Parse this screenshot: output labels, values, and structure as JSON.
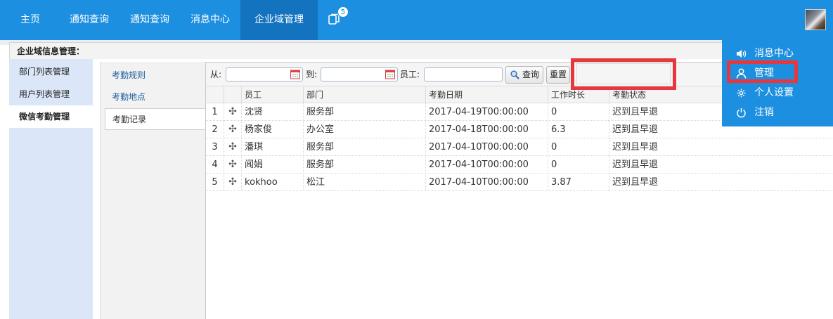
{
  "nav": {
    "items": [
      "主页",
      "通知查询",
      "通知查询",
      "消息中心",
      "企业域管理"
    ],
    "active_index": 4,
    "message_badge": "5"
  },
  "breadcrumb": "企业域信息管理：",
  "sidebar": {
    "items": [
      "部门列表管理",
      "用户列表管理",
      "微信考勤管理"
    ],
    "active_index": 2
  },
  "subsidebar": {
    "items": [
      "考勤规则",
      "考勤地点",
      "考勤记录"
    ],
    "active_index": 2
  },
  "toolbar": {
    "from_label": "从:",
    "from_value": "",
    "to_label": "到:",
    "to_value": "",
    "employee_label": "员工:",
    "employee_value": "",
    "search_button": "查询",
    "reset_button": "重置"
  },
  "table": {
    "columns": [
      "员工",
      "部门",
      "考勤日期",
      "工作时长",
      "考勤状态"
    ],
    "rows": [
      {
        "idx": "1",
        "employee": "沈贤",
        "dept": "服务部",
        "date": "2017-04-19T00:00:00",
        "hours": "0",
        "status": "迟到且早退"
      },
      {
        "idx": "2",
        "employee": "杨家俊",
        "dept": "办公室",
        "date": "2017-04-18T00:00:00",
        "hours": "6.3",
        "status": "迟到且早退"
      },
      {
        "idx": "3",
        "employee": "潘琪",
        "dept": "服务部",
        "date": "2017-04-10T00:00:00",
        "hours": "0",
        "status": "迟到且早退"
      },
      {
        "idx": "4",
        "employee": "闻娟",
        "dept": "服务部",
        "date": "2017-04-10T00:00:00",
        "hours": "0",
        "status": "迟到且早退"
      },
      {
        "idx": "5",
        "employee": "kokhoo",
        "dept": "松江",
        "date": "2017-04-10T00:00:00",
        "hours": "3.87",
        "status": "迟到且早退"
      }
    ]
  },
  "user_menu": {
    "items": [
      {
        "label": "消息中心",
        "icon": "speaker-icon"
      },
      {
        "label": "管理",
        "icon": "user-icon"
      },
      {
        "label": "个人设置",
        "icon": "gear-icon"
      },
      {
        "label": "注销",
        "icon": "power-icon"
      }
    ]
  },
  "colors": {
    "nav_bg": "#1d8fe0",
    "nav_active": "#1473bf",
    "highlight": "#e8373c",
    "sidebar_bg": "#dbe7f8"
  }
}
